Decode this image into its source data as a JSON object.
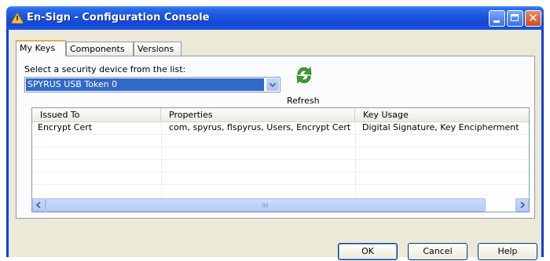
{
  "window": {
    "title": "En-Sign - Configuration Console"
  },
  "titlebar_buttons": {
    "close_glyph": "✕"
  },
  "tabs": [
    {
      "label": "My Keys",
      "active": true
    },
    {
      "label": "Components",
      "active": false
    },
    {
      "label": "Versions",
      "active": false
    }
  ],
  "device": {
    "label": "Select a security device from the list:",
    "selected": "SPYRUS USB Token 0"
  },
  "refresh": {
    "label": "Refresh"
  },
  "keys_table": {
    "columns": [
      "Issued To",
      "Properties",
      "Key Usage"
    ],
    "rows": [
      [
        "Encrypt Cert",
        "com, spyrus, flspyrus, Users, Encrypt Cert",
        "Digital Signature, Key Encipherment"
      ]
    ]
  },
  "buttons": {
    "ok": "OK",
    "cancel": "Cancel",
    "help": "Help"
  },
  "colors": {
    "title_bar": "#1a55de",
    "selection": "#316ac5",
    "dialog_bg": "#ece9d8"
  },
  "icons": {
    "app": "warning-triangle-icon",
    "refresh": "refresh-arrows-icon"
  }
}
